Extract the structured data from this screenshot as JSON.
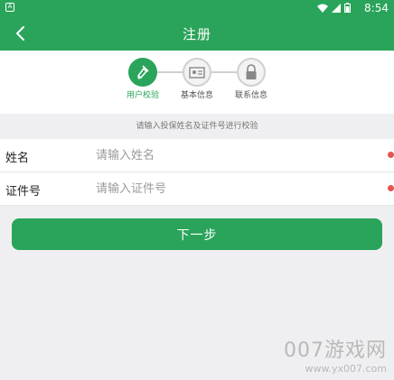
{
  "status_bar": {
    "time": "8:54",
    "left_badge": "A"
  },
  "header": {
    "title": "注册"
  },
  "steps": [
    {
      "label": "用户校验",
      "state": "active"
    },
    {
      "label": "基本信息",
      "state": "inactive"
    },
    {
      "label": "联系信息",
      "state": "inactive"
    }
  ],
  "hint": "请输入投保姓名及证件号进行校验",
  "form": {
    "fields": [
      {
        "label": "姓名",
        "placeholder": "请输入姓名"
      },
      {
        "label": "证件号",
        "placeholder": "请输入证件号"
      }
    ]
  },
  "actions": {
    "next_label": "下一步"
  },
  "watermark": {
    "line1": "007游戏网",
    "line2": "www.yx007.com"
  },
  "colors": {
    "primary": "#2aa45a",
    "required_dot": "#e25555"
  }
}
